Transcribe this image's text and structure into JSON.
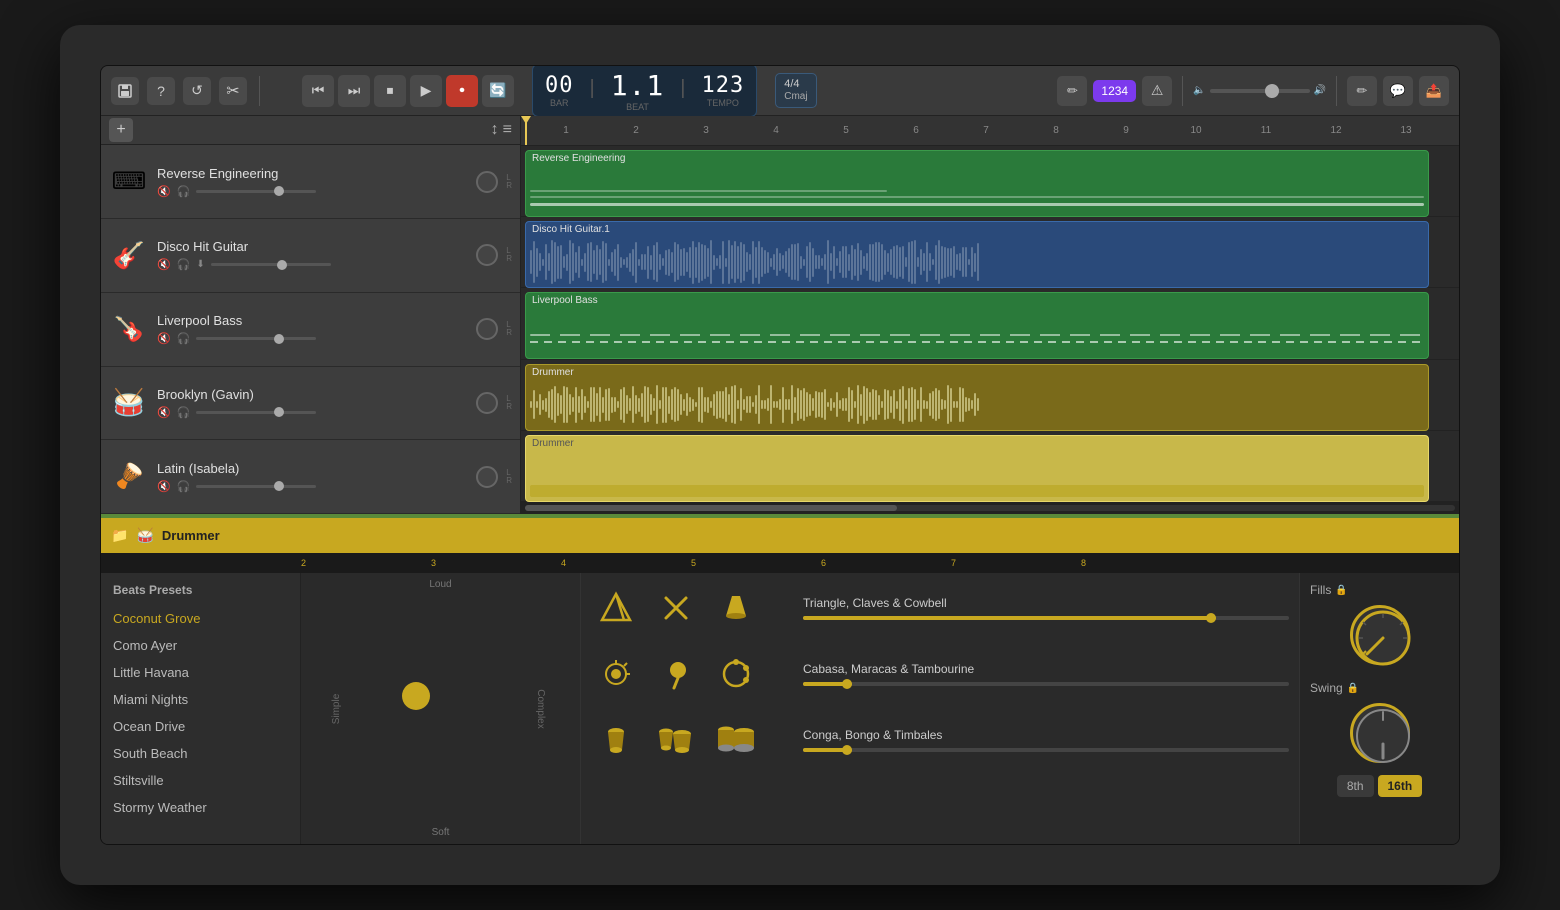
{
  "toolbar": {
    "time": {
      "bar": "00",
      "beat": "1.1",
      "tempo": "123",
      "bar_label": "BAR",
      "beat_label": "BEAT",
      "tempo_label": "TEMPO"
    },
    "key_signature": "4/4\nCmaj",
    "note_input": "1234",
    "pencil_label": "✏",
    "save_label": "💾",
    "help_label": "?",
    "undo_label": "↺",
    "cut_label": "✂"
  },
  "tracks": [
    {
      "name": "Reverse Engineering",
      "icon": "⌨",
      "type": "midi",
      "clip_color": "green",
      "clip_label": "Reverse Engineering"
    },
    {
      "name": "Disco Hit Guitar",
      "icon": "🎸",
      "type": "audio",
      "clip_color": "blue",
      "clip_label": "Disco Hit Guitar.1"
    },
    {
      "name": "Liverpool Bass",
      "icon": "🎸",
      "type": "midi",
      "clip_color": "green",
      "clip_label": "Liverpool Bass"
    },
    {
      "name": "Brooklyn (Gavin)",
      "icon": "🥁",
      "type": "drummer",
      "clip_color": "gold",
      "clip_label": "Drummer"
    },
    {
      "name": "Latin (Isabela)",
      "icon": "🪘",
      "type": "drummer",
      "clip_color": "gold_light",
      "clip_label": "Drummer"
    }
  ],
  "drummer": {
    "title": "Drummer",
    "presets_title": "Beats Presets",
    "presets": [
      {
        "name": "Coconut Grove",
        "active": true
      },
      {
        "name": "Como Ayer",
        "active": false
      },
      {
        "name": "Little Havana",
        "active": false
      },
      {
        "name": "Miami Nights",
        "active": false
      },
      {
        "name": "Ocean Drive",
        "active": false
      },
      {
        "name": "South Beach",
        "active": false
      },
      {
        "name": "Stiltsville",
        "active": false
      },
      {
        "name": "Stormy Weather",
        "active": false
      }
    ],
    "beat_canvas": {
      "top_label": "Loud",
      "bottom_label": "Soft",
      "left_label": "Simple",
      "right_label": "Complex"
    },
    "instruments": [
      {
        "name": "Triangle, Claves & Cowbell",
        "icons": [
          "△",
          "✕",
          "🔔"
        ],
        "active_count": 3,
        "slider_pct": 85
      },
      {
        "name": "Cabasa, Maracas & Tambourine",
        "icons": [
          "⊗",
          "⊕",
          "○"
        ],
        "active_count": 0,
        "slider_pct": 10
      },
      {
        "name": "Conga, Bongo & Timbales",
        "icons": [
          "▣",
          "▦",
          "▤"
        ],
        "active_count": 1,
        "slider_pct": 10
      }
    ],
    "fills_label": "Fills",
    "swing_label": "Swing",
    "note_8th": "8th",
    "note_16th": "16th",
    "ruler_marks": [
      "2",
      "3",
      "4",
      "5",
      "6",
      "7",
      "8"
    ]
  }
}
